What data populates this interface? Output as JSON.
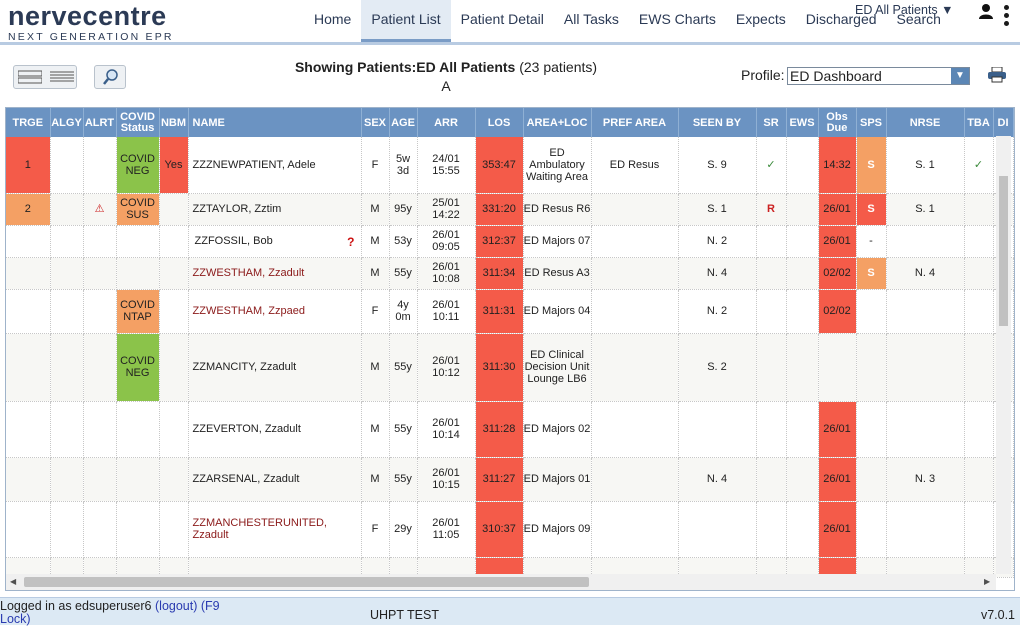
{
  "app": {
    "logo_main": "nervecentre",
    "logo_sub": "NEXT GENERATION EPR"
  },
  "nav": {
    "items": [
      "Home",
      "Patient List",
      "Patient Detail",
      "All Tasks",
      "EWS Charts",
      "Expects",
      "Discharged",
      "Search"
    ],
    "active": "Patient List",
    "ed_filter": "ED All Patients ▼"
  },
  "toolbar": {
    "showing_prefix": "Showing Patients:ED All Patients",
    "showing_count": " (23 patients)",
    "showing_sub": "A",
    "profile_label": "Profile:",
    "profile_value": "ED Dashboard"
  },
  "table": {
    "headers": [
      "TRGE",
      "ALGY",
      "ALRT",
      "COVID Status",
      "NBM",
      "NAME",
      "SEX",
      "AGE",
      "ARR",
      "LOS",
      "AREA+LOC",
      "PREF AREA",
      "SEEN BY",
      "SR",
      "EWS",
      "Obs Due",
      "SPS",
      "NRSE",
      "TBA",
      "DI"
    ],
    "rows": [
      {
        "trge": "1",
        "algy": "",
        "alrt": "",
        "covid": "COVID NEG",
        "nbm": "Yes",
        "name": "ZZZNEWPATIENT, Adele",
        "sex": "F",
        "age": "5w 3d",
        "arr": "24/01 15:55",
        "los": "353:47",
        "area": "ED Ambulatory Waiting Area",
        "pref": "ED Resus",
        "seen": "S. 9",
        "sr": "✓",
        "ews": "",
        "obs": "14:32",
        "sps": "S",
        "nrse": "S. 1",
        "tba": "✓"
      },
      {
        "trge": "2",
        "algy": "",
        "alrt": "⚠",
        "covid": "COVID SUS",
        "nbm": "",
        "name": "ZZTAYLOR, Zztim",
        "sex": "M",
        "age": "95y",
        "arr": "25/01 14:22",
        "los": "331:20",
        "area": "ED Resus R6",
        "pref": "",
        "seen": "S. 1",
        "sr": "R",
        "ews": "",
        "obs": "26/01",
        "sps": "S",
        "nrse": "S. 1",
        "tba": ""
      },
      {
        "trge": "",
        "algy": "",
        "alrt": "",
        "covid": "",
        "nbm": "",
        "name": "ZZFOSSIL, Bob",
        "name_icon": "?",
        "sex": "M",
        "age": "53y",
        "arr": "26/01 09:05",
        "los": "312:37",
        "area": "ED Majors 07",
        "pref": "",
        "seen": "N. 2",
        "sr": "",
        "ews": "",
        "obs": "26/01",
        "sps": "-",
        "nrse": "",
        "tba": ""
      },
      {
        "trge": "",
        "algy": "",
        "alrt": "",
        "covid": "",
        "nbm": "",
        "name": "ZZWESTHAM, Zzadult",
        "sex": "M",
        "age": "55y",
        "arr": "26/01 10:08",
        "los": "311:34",
        "area": "ED Resus A3",
        "pref": "",
        "seen": "N. 4",
        "sr": "",
        "ews": "",
        "obs": "02/02",
        "sps": "S",
        "nrse": "N. 4",
        "tba": ""
      },
      {
        "trge": "",
        "algy": "",
        "alrt": "",
        "covid": "COVID NTAP",
        "nbm": "",
        "name": "ZZWESTHAM, Zzpaed",
        "sex": "F",
        "age": "4y 0m",
        "arr": "26/01 10:11",
        "los": "311:31",
        "area": "ED Majors 04",
        "pref": "",
        "seen": "N. 2",
        "sr": "",
        "ews": "",
        "obs": "02/02",
        "sps": "",
        "nrse": "",
        "tba": ""
      },
      {
        "trge": "",
        "algy": "",
        "alrt": "",
        "covid": "COVID NEG",
        "nbm": "",
        "name": "ZZMANCITY, Zzadult",
        "sex": "M",
        "age": "55y",
        "arr": "26/01 10:12",
        "los": "311:30",
        "area": "ED Clinical Decision Unit Lounge LB6",
        "pref": "",
        "seen": "S. 2",
        "sr": "",
        "ews": "",
        "obs": "",
        "sps": "",
        "nrse": "",
        "tba": ""
      },
      {
        "trge": "",
        "algy": "",
        "alrt": "",
        "covid": "",
        "nbm": "",
        "name": "ZZEVERTON, Zzadult",
        "sex": "M",
        "age": "55y",
        "arr": "26/01 10:14",
        "los": "311:28",
        "area": "ED Majors 02",
        "pref": "",
        "seen": "",
        "sr": "",
        "ews": "",
        "obs": "26/01",
        "sps": "",
        "nrse": "",
        "tba": ""
      },
      {
        "trge": "",
        "algy": "",
        "alrt": "",
        "covid": "",
        "nbm": "",
        "name": "ZZARSENAL, Zzadult",
        "sex": "M",
        "age": "55y",
        "arr": "26/01 10:15",
        "los": "311:27",
        "area": "ED Majors 01",
        "pref": "",
        "seen": "N. 4",
        "sr": "",
        "ews": "",
        "obs": "26/01",
        "sps": "",
        "nrse": "N. 3",
        "tba": ""
      },
      {
        "trge": "",
        "algy": "",
        "alrt": "",
        "covid": "",
        "nbm": "",
        "name": "ZZMANCHESTERUNITED, Zzadult",
        "sex": "F",
        "age": "29y",
        "arr": "26/01 11:05",
        "los": "310:37",
        "area": "ED Majors 09",
        "pref": "",
        "seen": "",
        "sr": "",
        "ews": "",
        "obs": "26/01",
        "sps": "",
        "nrse": "",
        "tba": ""
      }
    ]
  },
  "footer": {
    "logged_in": "Logged in as edsuperuser6",
    "logout": "(logout)",
    "lock": "(F9 Lock)",
    "site": "UHPT TEST",
    "version": "v7.0.1"
  },
  "colors": {
    "header_bg": "#6b93c2",
    "alert_red": "#f45b49",
    "warn_orange": "#f4a064",
    "covid_green": "#8bc34a"
  },
  "icons": [
    "user-icon",
    "kebab-menu-icon",
    "view-large-icon",
    "view-list-icon",
    "search-icon",
    "printer-icon",
    "warning-icon",
    "question-icon"
  ]
}
